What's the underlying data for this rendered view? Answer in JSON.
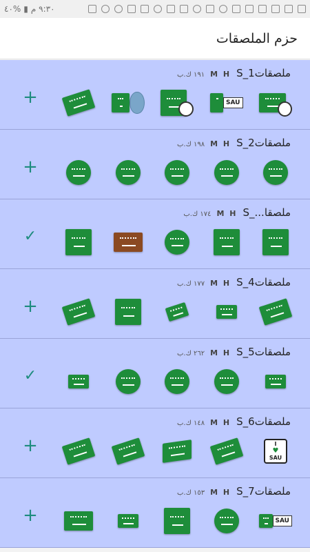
{
  "status_bar": {
    "time": "٩:٣٠ م",
    "battery": "%٤٠"
  },
  "app_bar": {
    "title": "حزم الملصقات"
  },
  "packs": [
    {
      "name": "ملصقات1_S",
      "author": "M H",
      "size": "١٩١ ك.ب",
      "action": "add",
      "stickers": [
        "flag-soccer-ball-icon",
        "flag-sau-icon",
        "flag-soccer-poster-icon",
        "flag-globe-icon",
        "flag-map-icon"
      ]
    },
    {
      "name": "ملصقات2_S",
      "author": "M H",
      "size": "١٩٨ ك.ب",
      "action": "add",
      "stickers": [
        "flag-round-badge-icon",
        "flag-gears-icon",
        "flag-ribbon-icon",
        "flag-sticker-peel-icon",
        "flag-round-button-icon"
      ]
    },
    {
      "name": "ملصقا..._S",
      "author": "M H",
      "size": "١٧٤ ك.ب",
      "action": "added",
      "stickers": [
        "flag-heart-icon",
        "flag-star-icon",
        "flag-cube-button-icon",
        "flag-suitcase-icon",
        "flag-square-icon"
      ]
    },
    {
      "name": "ملصقات4_S",
      "author": "M H",
      "size": "١٧٧ ك.ب",
      "action": "add",
      "stickers": [
        "flag-map-icon",
        "flag-pin-sign-icon",
        "flag-map-pin-icon",
        "flag-box-icon",
        "flag-wavy-icon"
      ]
    },
    {
      "name": "ملصقات5_S",
      "author": "M H",
      "size": "٢٦٢ ك.ب",
      "action": "added",
      "stickers": [
        "flag-airplane-icon",
        "flag-balloons-icon",
        "flag-balloons-2-icon",
        "flag-speech-bubble-icon",
        "flag-bunting-icon"
      ]
    },
    {
      "name": "ملصقات6_S",
      "author": "M H",
      "size": "١٤٨ ك.ب",
      "action": "add",
      "stickers": [
        "i-love-sau-icon",
        "flag-pole-icon",
        "flag-3d-icon",
        "flag-crossed-icon",
        "flag-waving-icon"
      ]
    },
    {
      "name": "ملصقات7_S",
      "author": "M H",
      "size": "١٥٣ ك.ب",
      "action": "add",
      "stickers": [
        "flag-sau-tag-icon",
        "flag-square-button-icon",
        "flag-square-dark-icon",
        "flag-sim-card-icon",
        "flag-grunge-icon"
      ]
    }
  ],
  "badges": {
    "sau_text": "SAU",
    "love_text": "I",
    "love_heart": "♥"
  },
  "colors": {
    "row_bg": "#bfcbff",
    "accent": "#1e8c7e",
    "flag_green": "#1e8d3a"
  }
}
